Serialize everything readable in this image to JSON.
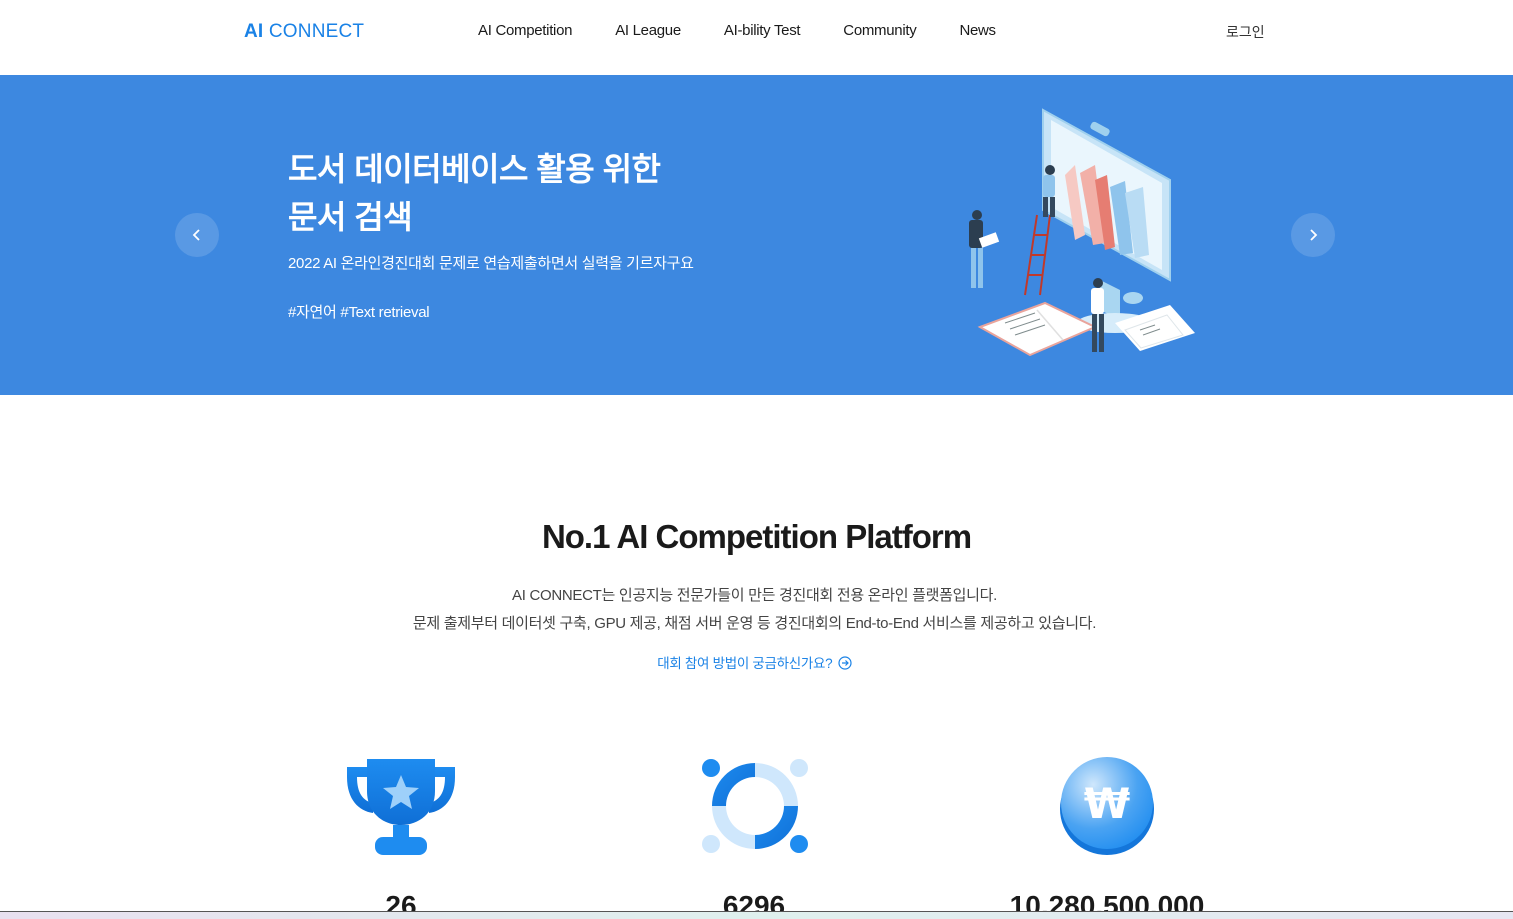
{
  "header": {
    "logo_ai": "AI",
    "logo_rest": "CONNECT",
    "nav": [
      "AI Competition",
      "AI League",
      "AI-bility Test",
      "Community",
      "News"
    ],
    "login": "로그인"
  },
  "hero": {
    "title_line1": "도서 데이터베이스 활용 위한",
    "title_line2": "문서 검색",
    "description": "2022 AI 온라인경진대회 문제로 연습제출하면서 실력을 기르자구요",
    "tags": "#자연어 #Text retrieval"
  },
  "platform": {
    "title": "No.1 AI Competition Platform",
    "desc_line1": "AI CONNECT는 인공지능 전문가들이 만든 경진대회 전용 온라인 플랫폼입니다.",
    "desc_line2": "문제 출제부터 데이터셋 구축, GPU 제공, 채점 서버 운영 등 경진대회의 End-to-End 서비스를 제공하고 있습니다.",
    "how_link": "대회 참여 방법이 궁금하신가요?"
  },
  "stats": [
    {
      "icon": "trophy-icon",
      "value": "26"
    },
    {
      "icon": "people-connect-icon",
      "value": "6296"
    },
    {
      "icon": "won-coin-icon",
      "value": "10,280,500,000"
    }
  ],
  "colors": {
    "accent": "#1a82e6",
    "hero_bg": "#3d88e0"
  }
}
